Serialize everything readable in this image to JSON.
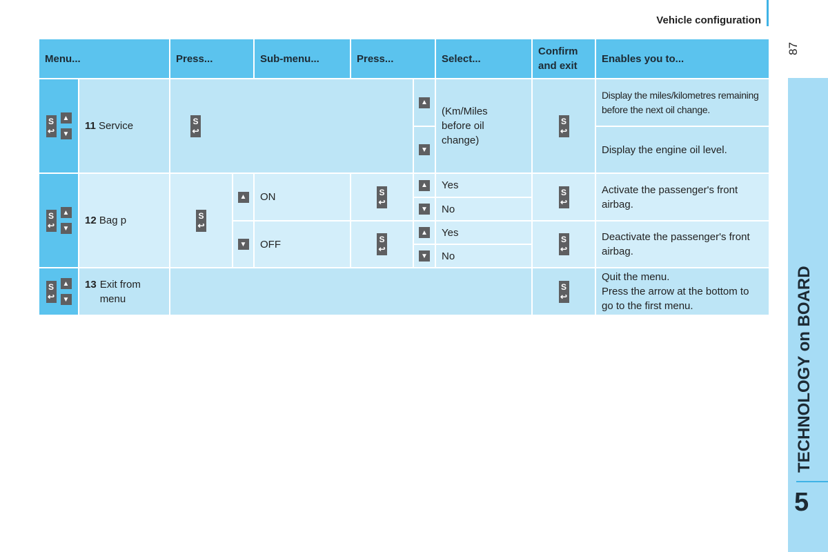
{
  "header": {
    "section": "Vehicle configuration",
    "page": "87"
  },
  "sidebar": {
    "chapter_number": "5",
    "chapter_title": "TECHNOLOGY on BOARD"
  },
  "table": {
    "columns": [
      "Menu...",
      "Press...",
      "Sub-menu...",
      "Press...",
      "Select...",
      "Confirm and exit",
      "Enables you to..."
    ],
    "rows": [
      {
        "num": "11",
        "label": "Service",
        "select": "(Km/Miles before oil change)",
        "enables": [
          "Display the miles/kilometres remaining before the next oil change.",
          "Display the engine oil level."
        ]
      },
      {
        "num": "12",
        "label": "Bag p",
        "submenus": [
          "ON",
          "OFF"
        ],
        "options": [
          "Yes",
          "No",
          "Yes",
          "No"
        ],
        "enables": [
          "Activate the passenger's front airbag.",
          "Deactivate the passenger's front airbag."
        ]
      },
      {
        "num": "13",
        "label": "Exit from menu",
        "enables": [
          "Quit the menu.",
          "Press the arrow at the bottom to go to the first menu."
        ]
      }
    ]
  },
  "icons": {
    "select_key": "S",
    "up": "▲",
    "down": "▼",
    "enter": "↩"
  },
  "colors": {
    "header": "#5bc3ee",
    "cell": "#bde5f6",
    "cell_light": "#d3eefa",
    "sidebar": "#a6dcf5"
  }
}
